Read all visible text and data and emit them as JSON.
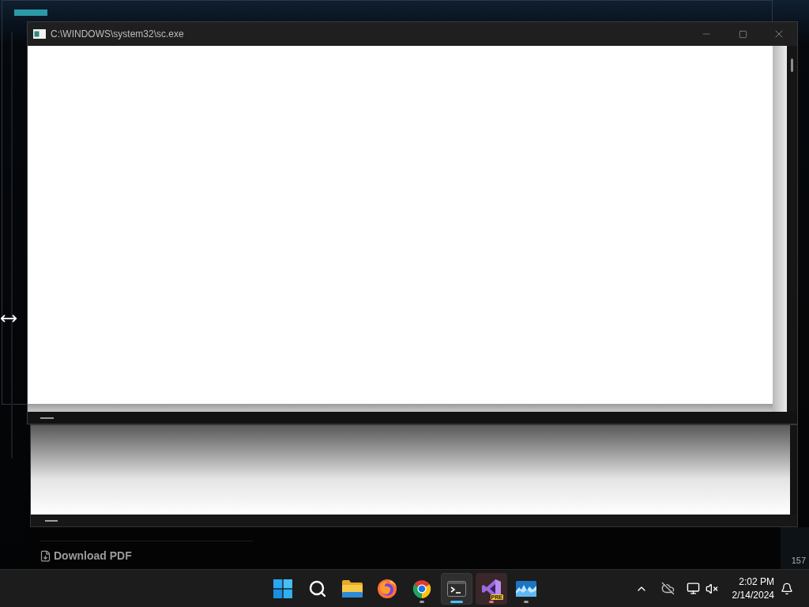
{
  "window": {
    "title": "C:\\WINDOWS\\system32\\sc.exe"
  },
  "background_page": {
    "link": "Download PDF",
    "side_number": "157"
  },
  "taskbar": {
    "apps": [
      {
        "kind": "start",
        "selected": false,
        "running": false,
        "attention": false
      },
      {
        "kind": "search",
        "selected": false,
        "running": false,
        "attention": false
      },
      {
        "kind": "folder",
        "selected": false,
        "running": false,
        "attention": false
      },
      {
        "kind": "firefox",
        "selected": false,
        "running": false,
        "attention": false
      },
      {
        "kind": "chrome",
        "selected": false,
        "running": true,
        "attention": false
      },
      {
        "kind": "terminal",
        "selected": true,
        "running": true,
        "attention": false
      },
      {
        "kind": "studio",
        "selected": false,
        "running": true,
        "attention": true,
        "badge": "PRE"
      },
      {
        "kind": "waves",
        "selected": false,
        "running": true,
        "attention": false
      }
    ],
    "clock": {
      "time": "2:02 PM",
      "date": "2/14/2024"
    }
  }
}
